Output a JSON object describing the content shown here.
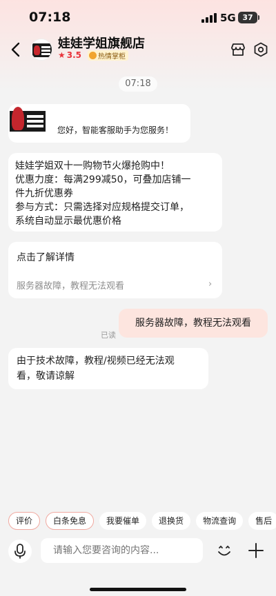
{
  "status_bar": {
    "time": "07:18",
    "network": "5G",
    "battery": "37"
  },
  "header": {
    "store_name": "娃娃学姐旗舰店",
    "rating": "3.5",
    "tag": "热情掌柜",
    "icons": {
      "back": "back-arrow-icon",
      "store": "store-icon",
      "settings": "settings-icon"
    }
  },
  "chat": {
    "timestamp": "07:18",
    "welcome": "您好，智能客服助手为您服务！",
    "promo_lines": [
      "娃娃学姐双十一购物节火爆抢购中！",
      "优惠力度：每满299减50，可叠加店铺一",
      "件九折优惠券",
      "参与方式：只需选择对应规格提交订单，",
      "系统自动显示最优惠价格"
    ],
    "card": {
      "title": "点击了解详情",
      "subtitle": "服务器故障，教程无法观看"
    },
    "user_message": "服务器故障，教程无法观看",
    "read_status": "已读",
    "reply_lines": [
      "由于技术故障，教程/视频已经无法观",
      "看，敬请谅解"
    ]
  },
  "quick_actions": [
    "评价",
    "白条免息",
    "我要催单",
    "退换货",
    "物流查询",
    "售后"
  ],
  "input": {
    "placeholder": "请输入您要咨询的内容..."
  },
  "colors": {
    "accent": "#e8333b",
    "user_bubble": "#fde5df",
    "background": "#f3f3f3"
  }
}
